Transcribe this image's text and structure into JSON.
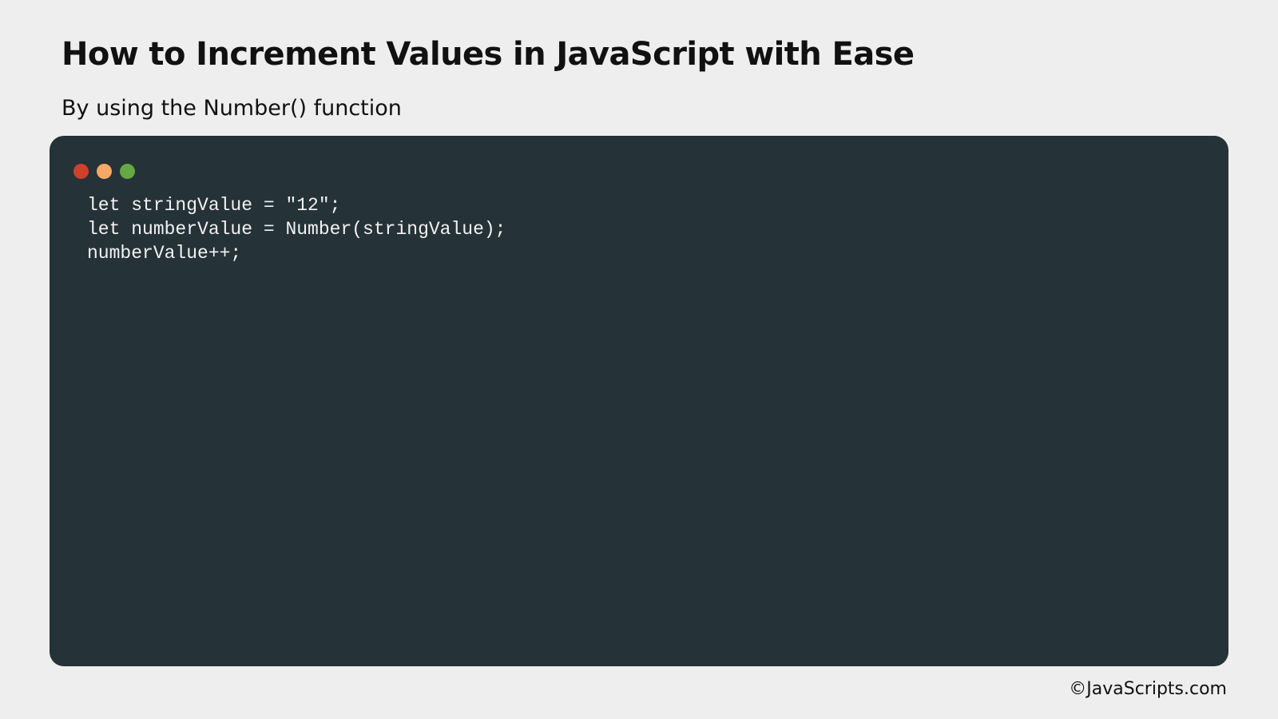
{
  "page": {
    "title": "How to Increment Values in JavaScript with Ease",
    "subtitle": "By using the Number() function"
  },
  "code_window": {
    "controls": [
      {
        "name": "close",
        "color": "#d0402b"
      },
      {
        "name": "minimize",
        "color": "#f4a964"
      },
      {
        "name": "maximize",
        "color": "#65a844"
      }
    ],
    "lines": [
      "let stringValue = \"12\";",
      "let numberValue = Number(stringValue);",
      "numberValue++;"
    ]
  },
  "footer": {
    "credit": "©JavaScripts.com"
  }
}
